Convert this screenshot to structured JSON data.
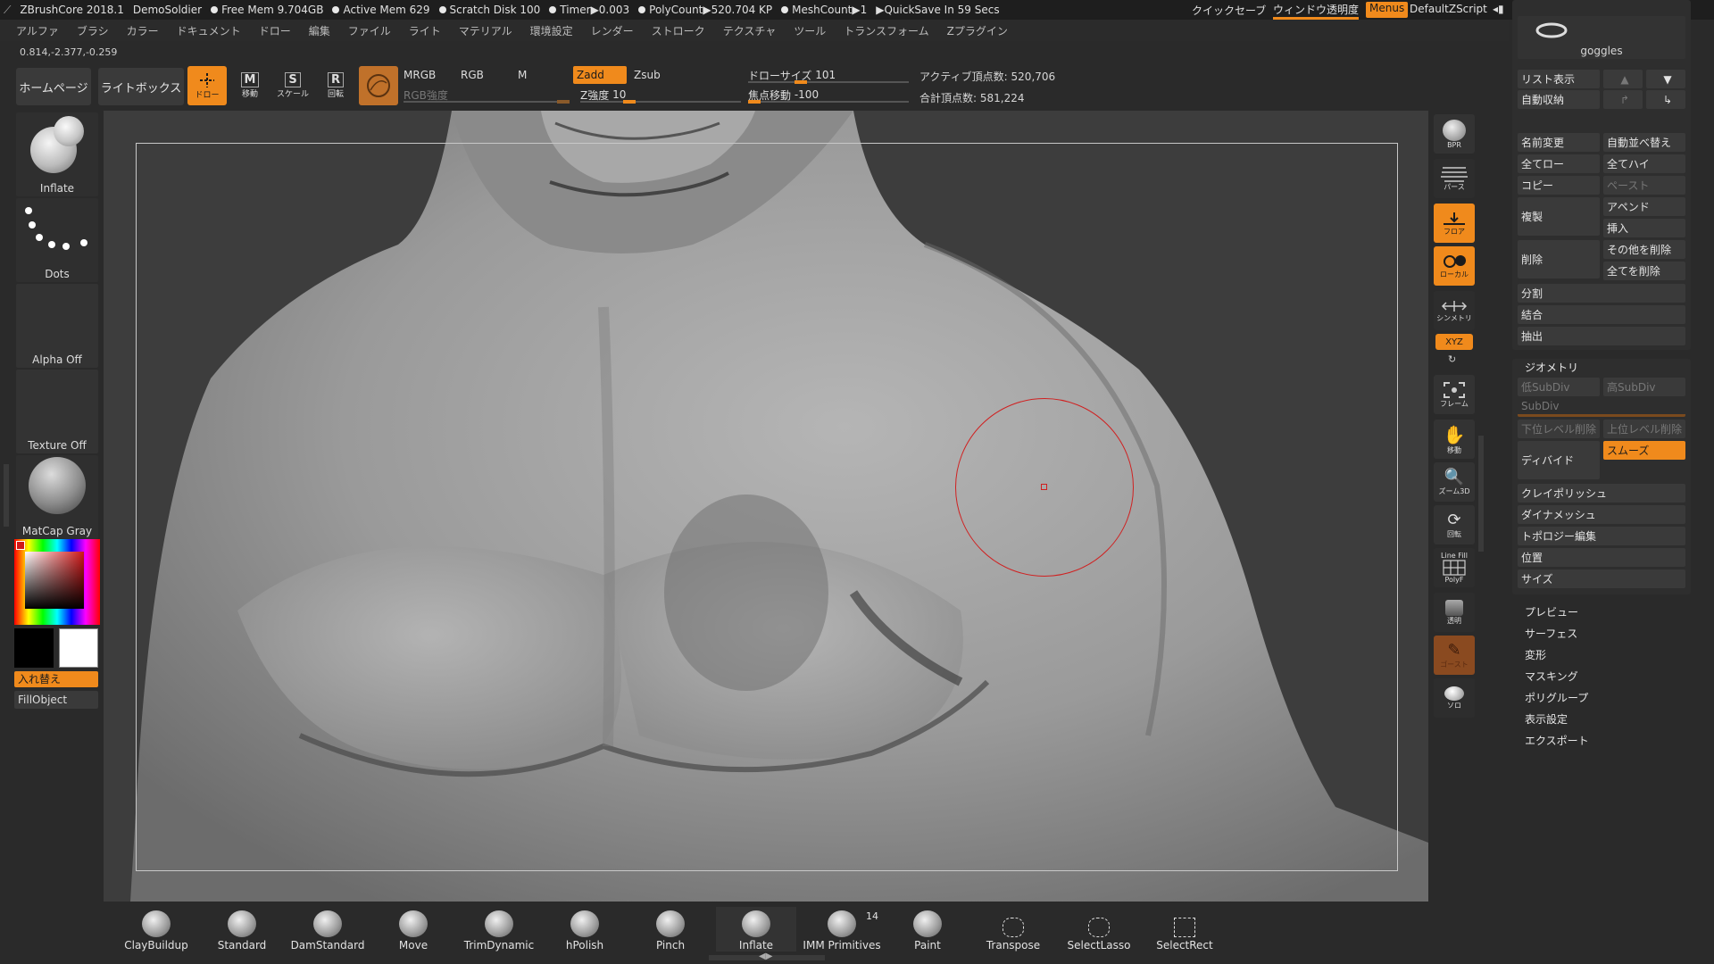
{
  "titlebar": {
    "app": "ZBrushCore 2018.1",
    "doc": "DemoSoldier",
    "free_mem": "Free Mem 9.704GB",
    "active_mem": "Active Mem 629",
    "scratch": "Scratch Disk 100",
    "timer": "Timer▶0.003",
    "polycount": "PolyCount▶520.704 KP",
    "meshcount": "MeshCount▶1",
    "quicksave": "▶QuickSave In 59 Secs",
    "quick_save_btn": "クイックセーブ",
    "window_transparency": "ウィンドウ透明度",
    "menus": "Menus",
    "default_zscript": "DefaultZScript"
  },
  "menubar": [
    "アルファ",
    "ブラシ",
    "カラー",
    "ドキュメント",
    "ドロー",
    "編集",
    "ファイル",
    "ライト",
    "マテリアル",
    "環境設定",
    "レンダー",
    "ストローク",
    "テクスチャ",
    "ツール",
    "トランスフォーム",
    "Zプラグイン"
  ],
  "coords": "0.814,-2.377,-0.259",
  "toolbar": {
    "home": "ホームページ",
    "lightbox": "ライトボックス",
    "draw": "ドロー",
    "move": "移動",
    "scale": "スケール",
    "rotate": "回転",
    "mrgb": "MRGB",
    "rgb": "RGB",
    "m": "M",
    "zadd": "Zadd",
    "zsub": "Zsub",
    "rgb_intensity": "RGB強度",
    "z_intensity_label": "Z強度",
    "z_intensity_value": "10",
    "draw_size_label": "ドローサイズ",
    "draw_size_value": "101",
    "focal_label": "焦点移動",
    "focal_value": "-100",
    "active_points": "アクティブ頂点数: 520,706",
    "total_points": "合計頂点数: 581,224"
  },
  "left": {
    "brush": "Inflate",
    "stroke": "Dots",
    "alpha": "Alpha Off",
    "texture": "Texture Off",
    "material": "MatCap Gray",
    "swap": "入れ替え",
    "fill": "FillObject",
    "primary_color": "#000000",
    "secondary_color": "#ffffff"
  },
  "shelf": {
    "bpr": "BPR",
    "perspective": "パース",
    "floor": "フロア",
    "local": "ローカル",
    "symmetry": "シンメトリ",
    "xyz": "XYZ",
    "frame": "フレーム",
    "move": "移動",
    "zoom": "ズーム3D",
    "rotate": "回転",
    "linefill": "Line Fill",
    "polyf": "PolyF",
    "transp": "透明",
    "ghost": "ゴースト",
    "solo": "ソロ"
  },
  "subtool": {
    "goggles": "goggles",
    "list": "リスト表示",
    "autocollapse": "自動収納",
    "rename": "名前変更",
    "autoreorder": "自動並べ替え",
    "alllow": "全てロー",
    "allhigh": "全てハイ",
    "copy": "コピー",
    "paste": "ペースト",
    "duplicate": "複製",
    "append": "アペンド",
    "insert": "挿入",
    "delete": "削除",
    "delother": "その他を削除",
    "delall": "全てを削除",
    "split": "分割",
    "merge": "結合",
    "extract": "抽出"
  },
  "geometry": {
    "title": "ジオメトリ",
    "lower": "低SubDiv",
    "higher": "高SubDiv",
    "subdiv": "SubDiv",
    "dellower": "下位レベル削除",
    "delhigher": "上位レベル削除",
    "divide": "ディバイド",
    "smooth": "スムーズ",
    "claypolish": "クレイポリッシュ",
    "dynamesh": "ダイナメッシュ",
    "topology": "トポロジー編集",
    "position": "位置",
    "size": "サイズ"
  },
  "panels": [
    "プレビュー",
    "サーフェス",
    "変形",
    "マスキング",
    "ポリグループ",
    "表示設定",
    "エクスポート"
  ],
  "brushes": [
    {
      "name": "ClayBuildup"
    },
    {
      "name": "Standard"
    },
    {
      "name": "DamStandard"
    },
    {
      "name": "Move"
    },
    {
      "name": "TrimDynamic"
    },
    {
      "name": "hPolish"
    },
    {
      "name": "Pinch"
    },
    {
      "name": "Inflate"
    },
    {
      "name": "IMM Primitives",
      "count": "14"
    },
    {
      "name": "Paint"
    },
    {
      "name": "Transpose"
    },
    {
      "name": "SelectLasso"
    },
    {
      "name": "SelectRect"
    }
  ],
  "colors": {
    "accent": "#f08a1c",
    "bg": "#2a2a2a",
    "cursor": "#d02020"
  }
}
